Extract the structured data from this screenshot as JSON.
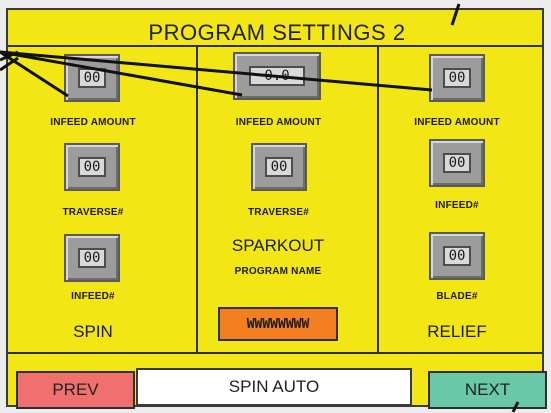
{
  "screen": {
    "title": "PROGRAM SETTINGS 2"
  },
  "spin": {
    "infeed_amount": {
      "value": "00",
      "label": "INFEED AMOUNT"
    },
    "traverse": {
      "value": "00",
      "label": "TRAVERSE#"
    },
    "infeed": {
      "value": "00",
      "label": "INFEED#"
    },
    "title": "SPIN"
  },
  "sparkout": {
    "infeed_amount": {
      "value": "0.0",
      "label": "INFEED AMOUNT"
    },
    "traverse": {
      "value": "00",
      "label": "TRAVERSE#"
    },
    "title": "SPARKOUT",
    "program_name_label": "PROGRAM NAME",
    "program_name_value": "WWWWWWWW"
  },
  "relief": {
    "infeed_amount": {
      "value": "00",
      "label": "INFEED AMOUNT"
    },
    "infeed": {
      "value": "00",
      "label": "INFEED#"
    },
    "blade": {
      "value": "00",
      "label": "BLADE#"
    },
    "title": "RELIEF"
  },
  "footer": {
    "prev_label": "PREV",
    "status_text": "SPIN AUTO",
    "next_label": "NEXT"
  },
  "colors": {
    "panel": "#f2e614",
    "prev": "#f07070",
    "next": "#68c8a8",
    "program_name": "#f37f20"
  }
}
